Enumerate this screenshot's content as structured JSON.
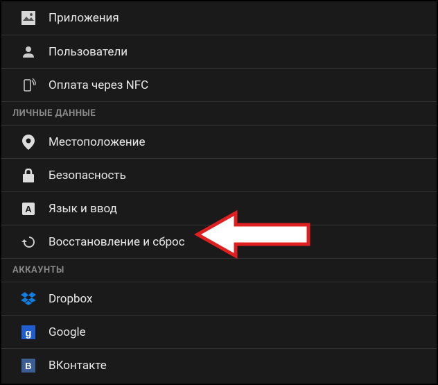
{
  "sections": [
    {
      "items": [
        {
          "icon": "apps-icon",
          "label": "Приложения"
        },
        {
          "icon": "users-icon",
          "label": "Пользователи"
        },
        {
          "icon": "nfc-icon",
          "label": "Оплата через NFC"
        }
      ]
    },
    {
      "header": "ЛИЧНЫЕ ДАННЫЕ",
      "items": [
        {
          "icon": "location-icon",
          "label": "Местоположение"
        },
        {
          "icon": "security-icon",
          "label": "Безопасность"
        },
        {
          "icon": "language-icon",
          "label": "Язык и ввод"
        },
        {
          "icon": "backup-reset-icon",
          "label": "Восстановление и сброс"
        }
      ]
    },
    {
      "header": "АККАУНТЫ",
      "items": [
        {
          "icon": "dropbox-icon",
          "label": "Dropbox"
        },
        {
          "icon": "google-icon",
          "label": "Google"
        },
        {
          "icon": "vkontakte-icon",
          "label": "ВКонтакте"
        }
      ]
    }
  ]
}
